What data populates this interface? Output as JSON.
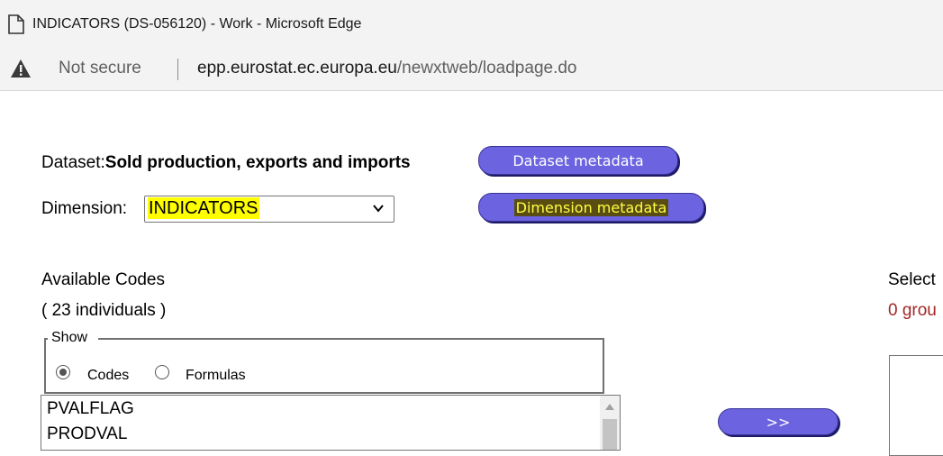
{
  "browser": {
    "window_title": "INDICATORS (DS-056120) - Work - Microsoft Edge",
    "security_label": "Not secure",
    "url_host": "epp.eurostat.ec.europa.eu",
    "url_path": "/newxtweb/loadpage.do"
  },
  "dataset": {
    "label": "Dataset:",
    "name": "Sold production, exports and imports",
    "metadata_button": "Dataset metadata"
  },
  "dimension": {
    "label": "Dimension:",
    "selected": "INDICATORS",
    "metadata_button": "Dimension metadata"
  },
  "available": {
    "title": "Available Codes",
    "count": "( 23 individuals )",
    "show_legend": "Show",
    "options": [
      {
        "label": "Codes",
        "checked": true
      },
      {
        "label": "Formulas",
        "checked": false
      }
    ],
    "items": [
      "PVALFLAG",
      "PRODVAL"
    ]
  },
  "selected": {
    "title": "Select",
    "count": "0 grou"
  },
  "move_button": ">>",
  "colors": {
    "pill": "#6b63df",
    "highlight": "#ffff00",
    "count_red": "#a12727"
  }
}
